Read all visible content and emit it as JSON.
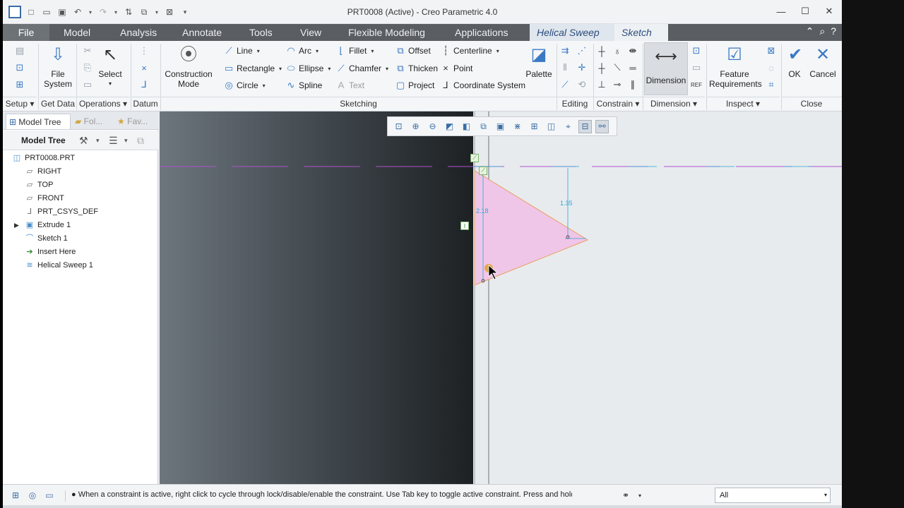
{
  "window": {
    "title": "PRT0008 (Active) - Creo Parametric 4.0",
    "controls": [
      "minimize-icon",
      "maximize-icon",
      "close-icon"
    ]
  },
  "tabs": [
    {
      "label": "File",
      "kind": "file"
    },
    {
      "label": "Model",
      "kind": "normal"
    },
    {
      "label": "Analysis",
      "kind": "normal"
    },
    {
      "label": "Annotate",
      "kind": "normal"
    },
    {
      "label": "Tools",
      "kind": "normal"
    },
    {
      "label": "View",
      "kind": "normal"
    },
    {
      "label": "Flexible Modeling",
      "kind": "normal"
    },
    {
      "label": "Applications",
      "kind": "normal"
    },
    {
      "label": "Helical Sweep",
      "kind": "context"
    },
    {
      "label": "Sketch",
      "kind": "active"
    }
  ],
  "ribbon": {
    "setup": {
      "footer": "Setup"
    },
    "get_data": {
      "file_system": "File\nSystem",
      "footer": "Get Data"
    },
    "operations": {
      "select": "Select",
      "footer": "Operations"
    },
    "datum": {
      "footer": "Datum"
    },
    "sketching": {
      "construction_mode": "Construction\nMode",
      "line": "Line",
      "rectangle": "Rectangle",
      "circle": "Circle",
      "arc": "Arc",
      "ellipse": "Ellipse",
      "spline": "Spline",
      "fillet": "Fillet",
      "chamfer": "Chamfer",
      "text": "Text",
      "offset": "Offset",
      "thicken": "Thicken",
      "project": "Project",
      "centerline": "Centerline",
      "point": "Point",
      "coordinate_system": "Coordinate System",
      "palette": "Palette",
      "footer": "Sketching"
    },
    "editing": {
      "footer": "Editing"
    },
    "constrain": {
      "footer": "Constrain"
    },
    "dimension": {
      "label": "Dimension",
      "footer": "Dimension"
    },
    "inspect": {
      "feature_requirements": "Feature\nRequirements",
      "footer": "Inspect"
    },
    "close": {
      "ok": "OK",
      "cancel": "Cancel",
      "footer": "Close"
    }
  },
  "left_panel": {
    "tabs": [
      "Model Tree",
      "Fol...",
      "Fav..."
    ],
    "header": "Model Tree",
    "items": [
      {
        "label": "PRT0008.PRT",
        "icon": "part-icon",
        "indent": 0
      },
      {
        "label": "RIGHT",
        "icon": "datum-plane-icon",
        "indent": 1
      },
      {
        "label": "TOP",
        "icon": "datum-plane-icon",
        "indent": 1
      },
      {
        "label": "FRONT",
        "icon": "datum-plane-icon",
        "indent": 1
      },
      {
        "label": "PRT_CSYS_DEF",
        "icon": "csys-icon",
        "indent": 1
      },
      {
        "label": "Extrude 1",
        "icon": "extrude-icon",
        "indent": 1,
        "expandable": true
      },
      {
        "label": "Sketch 1",
        "icon": "sketch-icon",
        "indent": 1
      },
      {
        "label": "Insert Here",
        "icon": "insert-arrow-icon",
        "indent": 1
      },
      {
        "label": "Helical Sweep 1",
        "icon": "helical-sweep-icon",
        "indent": 1
      }
    ]
  },
  "canvas": {
    "dimensions": {
      "d1": "2.18",
      "d2": "1.35"
    },
    "colors": {
      "fill": "#f0c6e8",
      "edge": "#e8a060",
      "dim": "#2aa6d8",
      "axis": "#b04fd0"
    }
  },
  "status": {
    "message": "When a constraint is active, right click to cycle through lock/disable/enable the constraint. Use Tab key to toggle active constraint. Press and hold S",
    "filter": "All"
  }
}
